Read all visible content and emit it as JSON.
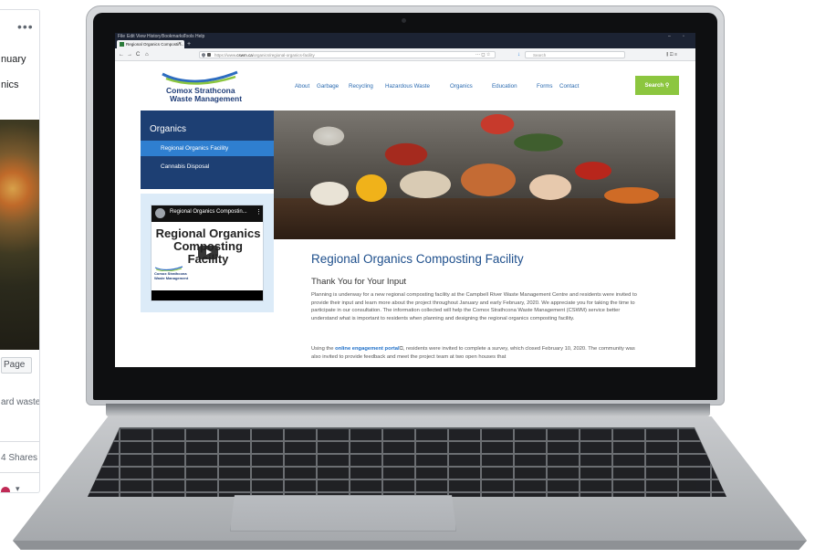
{
  "facebook_card": {
    "menu_dots": "•••",
    "text_january": "nuary",
    "text_organics": "nics",
    "page_button": "Page",
    "text_waste": "ard waste",
    "shares": "4 Shares",
    "caret": "▾"
  },
  "browser": {
    "menu": [
      "File",
      "Edit",
      "View",
      "History",
      "Bookmarks",
      "Tools",
      "Help"
    ],
    "tab_title": "Regional Organics Compostin...",
    "tab_close": "✕",
    "new_tab": "+",
    "window_controls": [
      "–",
      "▫"
    ],
    "nav_buttons": [
      "←",
      "→",
      "C",
      "⌂"
    ],
    "url_prefix": "https://www.",
    "url_domain": "cswm.ca",
    "url_path": "/organics/regional-organics-facility",
    "url_actions": "···  ◻  ☆",
    "download_icon": "↓",
    "search_placeholder": "Search",
    "toolbar_icons": "⫼  ◫  ≡"
  },
  "site": {
    "logo_line1": "Comox Strathcona",
    "logo_line2": "Waste Management",
    "nav": [
      "About",
      "Garbage",
      "Recycling",
      "Hazardous Waste",
      "Organics",
      "Education",
      "Forms",
      "Contact"
    ],
    "search_button": "Search",
    "sidebar": {
      "title": "Organics",
      "items": [
        "Regional Organics Facility",
        "Cannabis Disposal"
      ]
    },
    "video": {
      "bar_title": "Regional Organics Compostin...",
      "big_title": "Regional Organics Composting Facility",
      "logo_line1": "Comox Strathcona",
      "logo_line2": "Waste Management"
    },
    "page_title": "Regional Organics Composting Facility",
    "section_title": "Thank You for Your Input",
    "para1": "Planning is underway for a new regional composting facility at the Campbell River Waste Management Centre and residents were invited to provide their input and learn more about the project throughout January and early February, 2020. We appreciate you for taking the time to participate in our consultation. The information collected will help the Comox Strathcona Waste Management (CSWM) service better understand what is important to residents when planning and designing the regional organics composting facility.",
    "para2_before": "Using the ",
    "para2_link": "online engagement portal",
    "para2_after": ", residents were invited to complete a survey, which closed February 10, 2020. The community was also invited to provide feedback and meet the project team at two open houses that"
  },
  "colors": {
    "nav_blue": "#2a6ab0",
    "sidebar_navy": "#1d3f73",
    "sidebar_active": "#2f7fd0",
    "search_green": "#8cc63f",
    "title_blue": "#1e4f8c"
  }
}
